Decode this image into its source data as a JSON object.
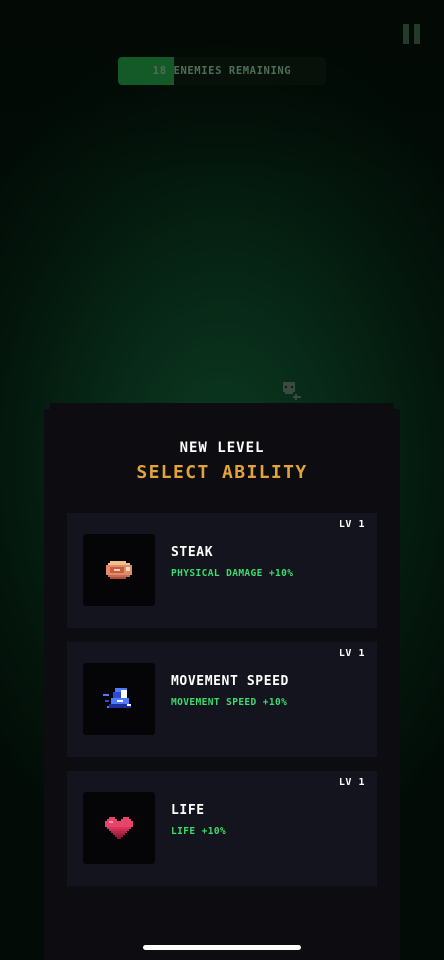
{
  "hud": {
    "enemies_text": "18 ENEMIES REMAINING",
    "enemies_progress": 0.27,
    "pause_icon": "pause-icon"
  },
  "dialog": {
    "subtitle": "NEW LEVEL",
    "title": "SELECT ABILITY",
    "cards": [
      {
        "level": "LV 1",
        "name": "STEAK",
        "description": "PHYSICAL DAMAGE +10%",
        "icon": "steak-icon"
      },
      {
        "level": "LV 1",
        "name": "MOVEMENT SPEED",
        "description": "MOVEMENT SPEED +10%",
        "icon": "boot-icon"
      },
      {
        "level": "LV 1",
        "name": "LIFE",
        "description": "LIFE +10%",
        "icon": "heart-icon"
      }
    ]
  },
  "colors": {
    "title_gold": "#e2a43a",
    "desc_green": "#3ddc6f",
    "card_bg": "#14141f",
    "progress_fill": "#145a28"
  }
}
